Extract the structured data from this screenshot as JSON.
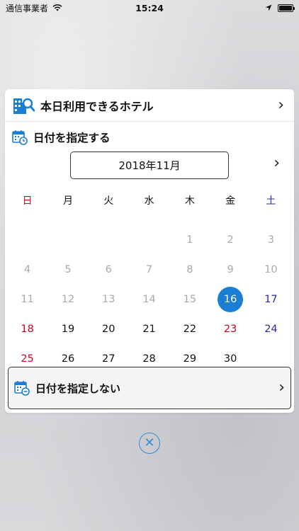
{
  "status_bar": {
    "carrier": "通信事業者",
    "time": "15:24"
  },
  "hotel_today": {
    "label": "本日利用できるホテル"
  },
  "date_section": {
    "label": "日付を指定する"
  },
  "calendar": {
    "month_label": "2018年11月",
    "weekdays": [
      "日",
      "月",
      "火",
      "水",
      "木",
      "金",
      "土"
    ],
    "week1": [
      "",
      "",
      "",
      "",
      "1",
      "2",
      "3"
    ],
    "week2": [
      "4",
      "5",
      "6",
      "7",
      "8",
      "9",
      "10"
    ],
    "week3": [
      "11",
      "12",
      "13",
      "14",
      "15",
      "16",
      "17"
    ],
    "week4": [
      "18",
      "19",
      "20",
      "21",
      "22",
      "23",
      "24"
    ],
    "week5": [
      "25",
      "26",
      "27",
      "28",
      "29",
      "30",
      ""
    ],
    "selected_day": "16"
  },
  "no_date": {
    "label": "日付を指定しない"
  },
  "colors": {
    "accent": "#1a7fd4",
    "sunday": "#d0021b",
    "saturday": "#2a2aa8",
    "past": "#a8a8ad"
  }
}
